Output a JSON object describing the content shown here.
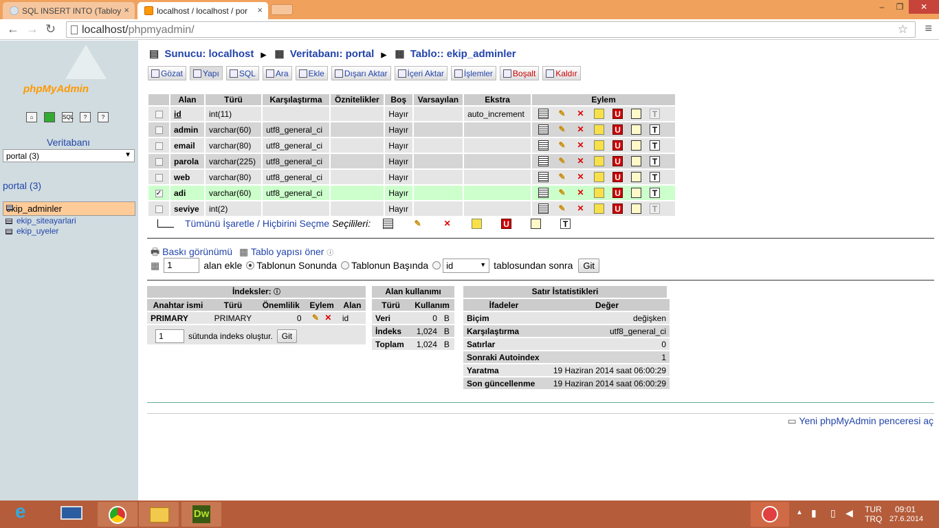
{
  "browser": {
    "tabs": [
      {
        "title": "SQL INSERT INTO (Tabloy",
        "close": "×"
      },
      {
        "title": "localhost / localhost / por",
        "close": "×"
      }
    ],
    "url_host": "localhost/",
    "url_path": "phpmyadmin/",
    "window_controls": [
      "–",
      "❐",
      "✕"
    ]
  },
  "sidebar": {
    "logo": "phpMyAdmin",
    "db_label": "Veritabanı",
    "db_select": "portal (3)",
    "db_title": "portal (3)",
    "tables": [
      "ekip_adminler",
      "ekip_siteayarlari",
      "ekip_uyeler"
    ]
  },
  "breadcrumb": {
    "server": "Sunucu: localhost",
    "database": "Veritabanı: portal",
    "table": "Tablo:: ekip_adminler"
  },
  "tabs": [
    "Gözat",
    "Yapı",
    "SQL",
    "Ara",
    "Ekle",
    "Dışarı Aktar",
    "İçeri Aktar",
    "İşlemler",
    "Boşalt",
    "Kaldır"
  ],
  "structure": {
    "headers": [
      "Alan",
      "Türü",
      "Karşılaştırma",
      "Öznitelikler",
      "Boş",
      "Varsayılan",
      "Ekstra",
      "Eylem"
    ],
    "rows": [
      {
        "name": "id",
        "type": "int(11)",
        "collation": "",
        "attr": "",
        "null": "Hayır",
        "default": "",
        "extra": "auto_increment",
        "checked": false
      },
      {
        "name": "admin",
        "type": "varchar(60)",
        "collation": "utf8_general_ci",
        "attr": "",
        "null": "Hayır",
        "default": "",
        "extra": "",
        "checked": false
      },
      {
        "name": "email",
        "type": "varchar(80)",
        "collation": "utf8_general_ci",
        "attr": "",
        "null": "Hayır",
        "default": "",
        "extra": "",
        "checked": false
      },
      {
        "name": "parola",
        "type": "varchar(225)",
        "collation": "utf8_general_ci",
        "attr": "",
        "null": "Hayır",
        "default": "",
        "extra": "",
        "checked": false
      },
      {
        "name": "web",
        "type": "varchar(80)",
        "collation": "utf8_general_ci",
        "attr": "",
        "null": "Hayır",
        "default": "",
        "extra": "",
        "checked": false
      },
      {
        "name": "adi",
        "type": "varchar(60)",
        "collation": "utf8_general_ci",
        "attr": "",
        "null": "Hayır",
        "default": "",
        "extra": "",
        "checked": true
      },
      {
        "name": "seviye",
        "type": "int(2)",
        "collation": "",
        "attr": "",
        "null": "Hayır",
        "default": "",
        "extra": "",
        "checked": false
      }
    ],
    "check_all": "Tümünü İşaretle / Hiçbirini Seçme",
    "with_selected": "Seçilileri:"
  },
  "print_view": "Baskı görünümü",
  "propose": "Tablo yapısı öner",
  "add_field": {
    "count": "1",
    "label": "alan ekle",
    "opt_end": "Tablonun Sonunda",
    "opt_begin": "Tablonun Başında",
    "after_field": "id",
    "after_label": "tablosundan sonra",
    "go": "Git"
  },
  "indexes": {
    "title": "İndeksler:",
    "headers": [
      "Anahtar ismi",
      "Türü",
      "Önemlilik",
      "Eylem",
      "Alan"
    ],
    "row": {
      "key": "PRIMARY",
      "type": "PRIMARY",
      "cardinality": "0",
      "field": "id"
    },
    "create_count": "1",
    "create_label": "sütunda indeks oluştur.",
    "go": "Git"
  },
  "space": {
    "title": "Alan kullanımı",
    "headers": [
      "Türü",
      "Kullanım"
    ],
    "rows": [
      {
        "type": "Veri",
        "value": "0",
        "unit": "B"
      },
      {
        "type": "İndeks",
        "value": "1,024",
        "unit": "B"
      },
      {
        "type": "Toplam",
        "value": "1,024",
        "unit": "B"
      }
    ]
  },
  "stats": {
    "title": "Satır İstatistikleri",
    "headers": [
      "İfadeler",
      "Değer"
    ],
    "rows": [
      {
        "k": "Biçim",
        "v": "değişken"
      },
      {
        "k": "Karşılaştırma",
        "v": "utf8_general_ci"
      },
      {
        "k": "Satırlar",
        "v": "0"
      },
      {
        "k": "Sonraki Autoindex",
        "v": "1"
      },
      {
        "k": "Yaratma",
        "v": "19 Haziran 2014 saat 06:00:29"
      },
      {
        "k": "Son güncellenme",
        "v": "19 Haziran 2014 saat 06:00:29"
      }
    ]
  },
  "new_window": "Yeni phpMyAdmin penceresi aç",
  "taskbar": {
    "lang1": "TUR",
    "lang2": "TRQ",
    "time": "09:01",
    "date": "27.6.2014",
    "dw_label": "Dw"
  }
}
